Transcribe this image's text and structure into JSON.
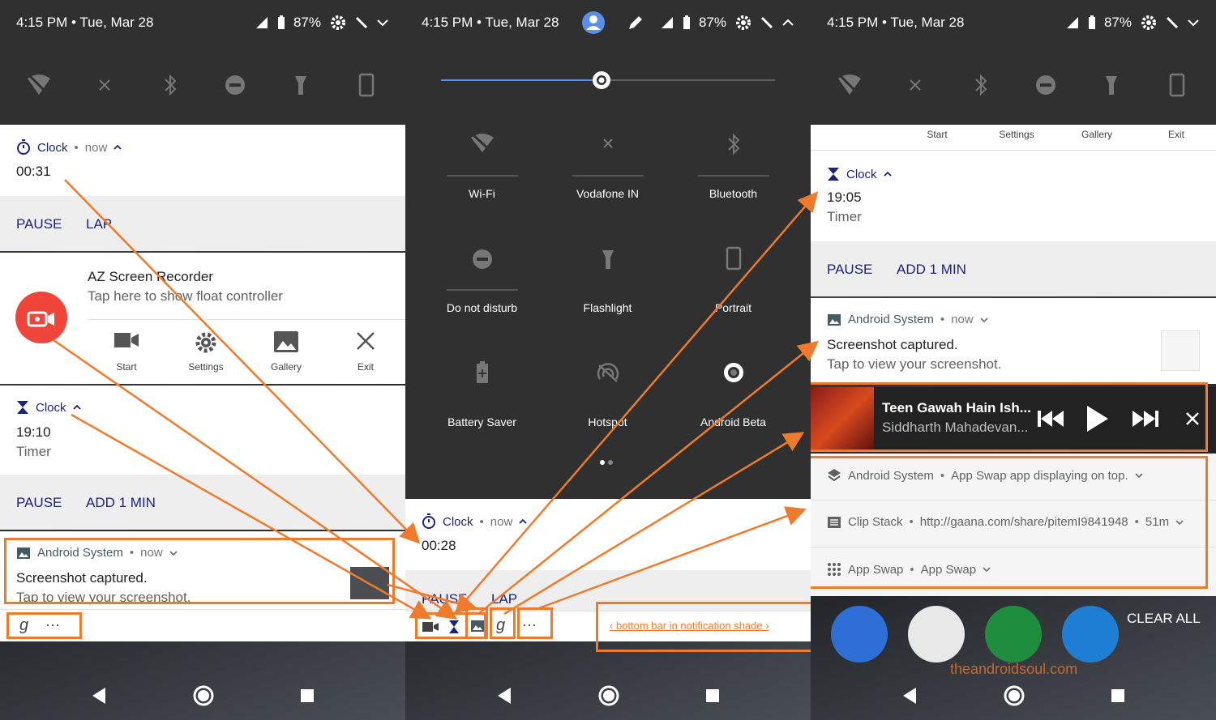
{
  "status": {
    "time": "4:15 PM",
    "date": "Tue, Mar 28",
    "battery": "87%",
    "sep": "•"
  },
  "panel1": {
    "clock1": {
      "app": "Clock",
      "when": "now",
      "value": "00:31",
      "pause": "PAUSE",
      "lap": "LAP"
    },
    "recorder": {
      "title": "AZ Screen Recorder",
      "subtitle": "Tap here to show float controller",
      "actions": [
        "Start",
        "Settings",
        "Gallery",
        "Exit"
      ]
    },
    "clock2": {
      "app": "Clock",
      "value": "19:10",
      "sub": "Timer",
      "pause": "PAUSE",
      "add": "ADD 1 MIN"
    },
    "screenshot": {
      "app": "Android System",
      "when": "now",
      "title": "Screenshot captured.",
      "sub": "Tap to view your screenshot."
    },
    "bottom": {
      "more": "···"
    }
  },
  "panel2": {
    "tiles": [
      {
        "label": "Wi-Fi",
        "icon": "wifi-off-icon"
      },
      {
        "label": "Vodafone IN",
        "icon": "no-signal-icon"
      },
      {
        "label": "Bluetooth",
        "icon": "bluetooth-icon"
      },
      {
        "label": "Do not disturb",
        "icon": "dnd-icon"
      },
      {
        "label": "Flashlight",
        "icon": "flashlight-icon"
      },
      {
        "label": "Portrait",
        "icon": "portrait-icon"
      },
      {
        "label": "Battery Saver",
        "icon": "battery-saver-icon"
      },
      {
        "label": "Hotspot",
        "icon": "hotspot-icon"
      },
      {
        "label": "Android Beta",
        "icon": "android-beta-icon"
      }
    ],
    "brightness": 0.48,
    "clock": {
      "app": "Clock",
      "when": "now",
      "value": "00:28",
      "pause": "PAUSE",
      "lap": "LAP"
    },
    "annotation": "‹ bottom bar in notification shade ›",
    "more": "···"
  },
  "panel3": {
    "rec_actions": [
      "Start",
      "Settings",
      "Gallery",
      "Exit"
    ],
    "clock": {
      "app": "Clock",
      "value": "19:05",
      "sub": "Timer",
      "pause": "PAUSE",
      "add": "ADD 1 MIN"
    },
    "screenshot": {
      "app": "Android System",
      "when": "now",
      "title": "Screenshot captured.",
      "sub": "Tap to view your screenshot."
    },
    "media": {
      "title": "Teen Gawah Hain Ish...",
      "artist": "Siddharth Mahadevan..."
    },
    "rows": [
      {
        "app": "Android System",
        "text": "App Swap app displaying on top."
      },
      {
        "app": "Clip Stack",
        "text": "http://gaana.com/share/pitemI9841948",
        "extra": "51m"
      },
      {
        "app": "App Swap",
        "text": "App Swap"
      }
    ],
    "clear_all": "CLEAR ALL",
    "watermark": "theandroidsoul.com"
  },
  "colors": {
    "accent": "#1a237e",
    "annotation": "#f07a2c",
    "dark": "#303030",
    "recorder": "#f0453a"
  }
}
